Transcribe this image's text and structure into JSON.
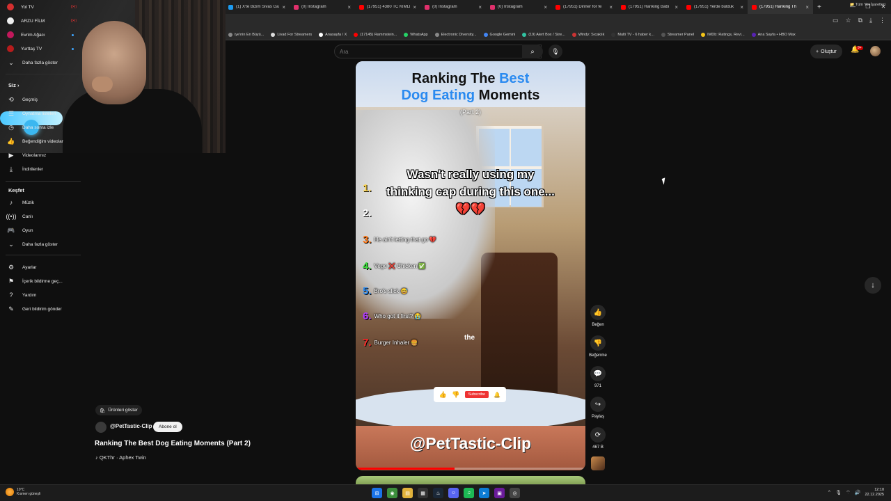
{
  "browser": {
    "tabs": [
      {
        "label": "(1) X'te Bizim Sivas Gaz",
        "color": "#1d9bf0",
        "active": false
      },
      {
        "label": "(0) Instagram",
        "color": "#e1306c",
        "active": false
      },
      {
        "label": "(17951) 4380 TC KİMLİ",
        "color": "#ff0000",
        "active": false
      },
      {
        "label": "(0) Instagram",
        "color": "#e1306c",
        "active": false
      },
      {
        "label": "(0) Instagram",
        "color": "#e1306c",
        "active": false
      },
      {
        "label": "(17951) Dinner for fe",
        "color": "#ff0000",
        "active": false
      },
      {
        "label": "(17951) Ranking Babi",
        "color": "#ff0000",
        "active": false
      },
      {
        "label": "(17951) Yerde bulduk",
        "color": "#ff0000",
        "active": false
      },
      {
        "label": "(17951) Ranking Th",
        "color": "#ff0000",
        "active": true
      }
    ],
    "bookmarks": [
      {
        "label": "iye'nin En Büyü...",
        "color": "#888888"
      },
      {
        "label": "Livad For Streamers",
        "color": "#dddddd"
      },
      {
        "label": "Anasayfa / X",
        "color": "#ffffff"
      },
      {
        "label": "(17145) Rammstein...",
        "color": "#ff0000"
      },
      {
        "label": "WhatsApp",
        "color": "#25d366"
      },
      {
        "label": "Electronic Diversity...",
        "color": "#888888"
      },
      {
        "label": "Google Gemini",
        "color": "#4285f4"
      },
      {
        "label": "(19) Alert Box / Stre...",
        "color": "#31c3a2"
      },
      {
        "label": "Windy: Sıcaklık",
        "color": "#cc3333"
      },
      {
        "label": "Multi TV - 6 haber k...",
        "color": "#333333"
      },
      {
        "label": "Streamer Panel",
        "color": "#555555"
      },
      {
        "label": "IMDb: Ratings, Revi...",
        "color": "#f5c518"
      },
      {
        "label": "Ana Sayfa • HBO Max",
        "color": "#5822b4"
      }
    ],
    "bookmarks_all": "Tüm Yer İşaretleri"
  },
  "topbar": {
    "search_placeholder": "Ara",
    "create_label": "Oluştur",
    "notif_count": "9+"
  },
  "sidebar": {
    "channels": [
      {
        "label": "Yol TV",
        "color": "#d32f2f",
        "badge": "live"
      },
      {
        "label": "ARZU FİLM",
        "color": "#eeeeee",
        "badge": "live"
      },
      {
        "label": "Evrim Ağacı",
        "color": "#c2185b",
        "badge": "dot"
      },
      {
        "label": "Yurttaş TV",
        "color": "#b71c1c",
        "badge": "dot"
      }
    ],
    "show_more": "Daha fazla göster",
    "you_header": "Siz",
    "you_items": [
      "Geçmiş",
      "Oynatma listeleri",
      "Daha sonra izle",
      "Beğendiğim videolar",
      "Videolarınız",
      "İndirilenler"
    ],
    "explore_header": "Keşfet",
    "explore_items": [
      "Müzik",
      "Canlı",
      "Oyun"
    ],
    "explore_more": "Daha fazla göster",
    "footer_items": [
      "Ayarlar",
      "İçerik bildirme geç...",
      "Yardım",
      "Geri bildirim gönder"
    ]
  },
  "short": {
    "overlay_title_a": "Ranking The ",
    "overlay_title_a_blue": "Best",
    "overlay_title_b_blue": "Dog Eating",
    "overlay_title_b": " Moments",
    "overlay_part": "(Part 2)",
    "caption": "Wasn't really using my thinking cap during this one...💔💔",
    "rankings": [
      {
        "num": "1.",
        "text": "",
        "color": "#ffd54a"
      },
      {
        "num": "2.",
        "text": "",
        "color": "#ffffff"
      },
      {
        "num": "3.",
        "text": "He ain't letting that go 💔",
        "color": "#ff7a1a"
      },
      {
        "num": "4.",
        "text": "Vege ❌ Chicken ✅",
        "color": "#3ddc3d"
      },
      {
        "num": "5.",
        "text": "Bro's slick 😅",
        "color": "#2a8af0"
      },
      {
        "num": "6.",
        "text": "Who got it first? 😭",
        "color": "#b13cff"
      },
      {
        "num": "7.",
        "text": "Burger Inhaler 🍔",
        "color": "#ff2a2a"
      }
    ],
    "subtitle_word": "the",
    "mini_subscribe": "Subscribe",
    "handle_overlay": "@PetTastic-Clip",
    "progress": 0.43,
    "products_label": "Ürünleri göster",
    "channel": "@PetTastic-Clip",
    "subscribe_label": "Abone ol",
    "title": "Ranking The Best Dog Eating Moments (Part 2)",
    "music": "♪ QKThr · Aphex Twin"
  },
  "actions": {
    "like_label": "Beğen",
    "dislike_label": "Beğenme",
    "comments_count": "971",
    "share_label": "Paylaş",
    "remix_count": "467 B"
  },
  "taskbar": {
    "temp": "10°C",
    "weather": "Kısmen güneşli",
    "time": "12:10",
    "date": "22.12.2025"
  }
}
